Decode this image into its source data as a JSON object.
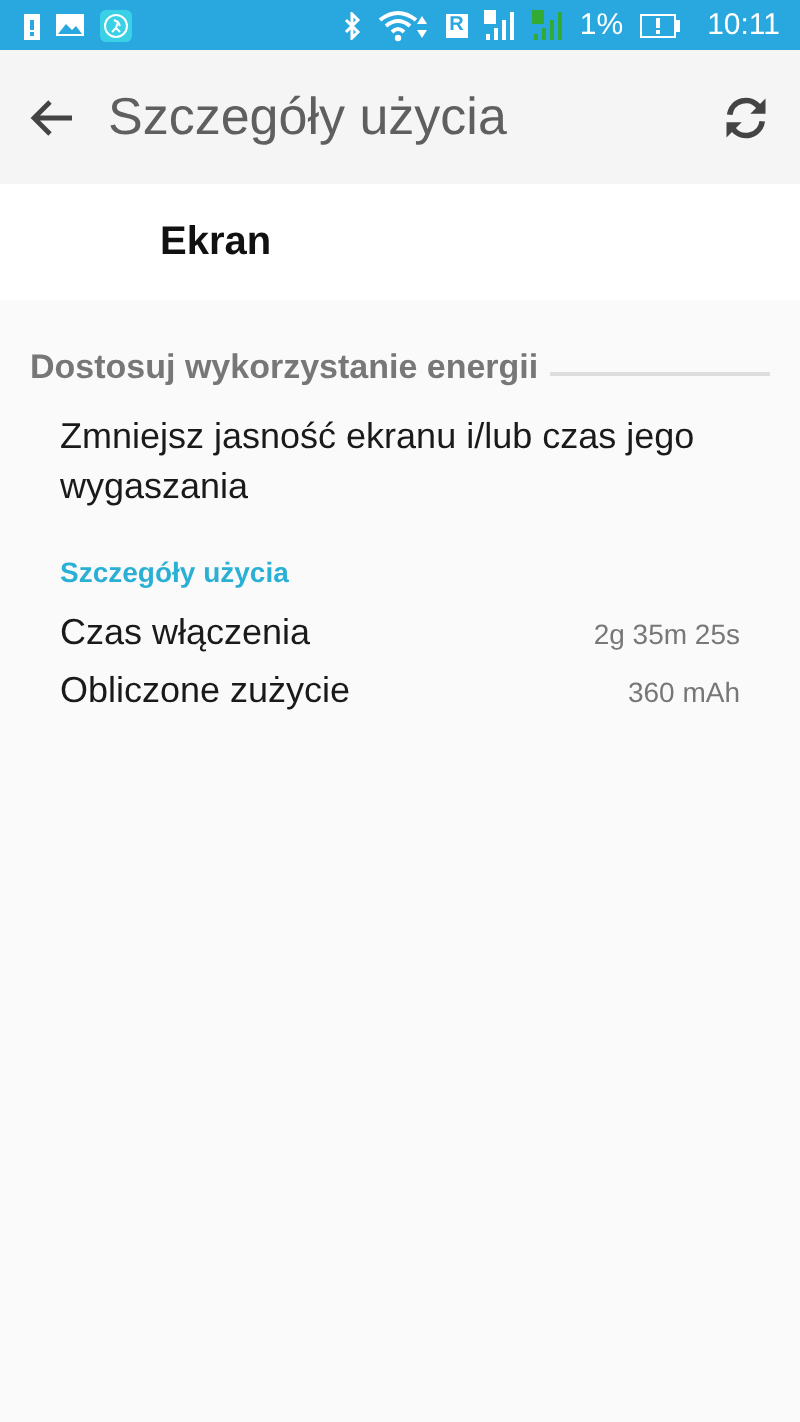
{
  "status_bar": {
    "roaming": "R",
    "battery": "1%",
    "time": "10:11"
  },
  "app_bar": {
    "title": "Szczegóły użycia"
  },
  "header": {
    "title": "Ekran"
  },
  "section": {
    "title": "Dostosuj wykorzystanie energii",
    "tip": "Zmniejsz jasność ekranu i/lub czas jego wygaszania"
  },
  "details": {
    "title": "Szczegóły użycia",
    "rows": [
      {
        "label": "Czas włączenia",
        "value": "2g 35m 25s"
      },
      {
        "label": "Obliczone zużycie",
        "value": "360 mAh"
      }
    ]
  }
}
